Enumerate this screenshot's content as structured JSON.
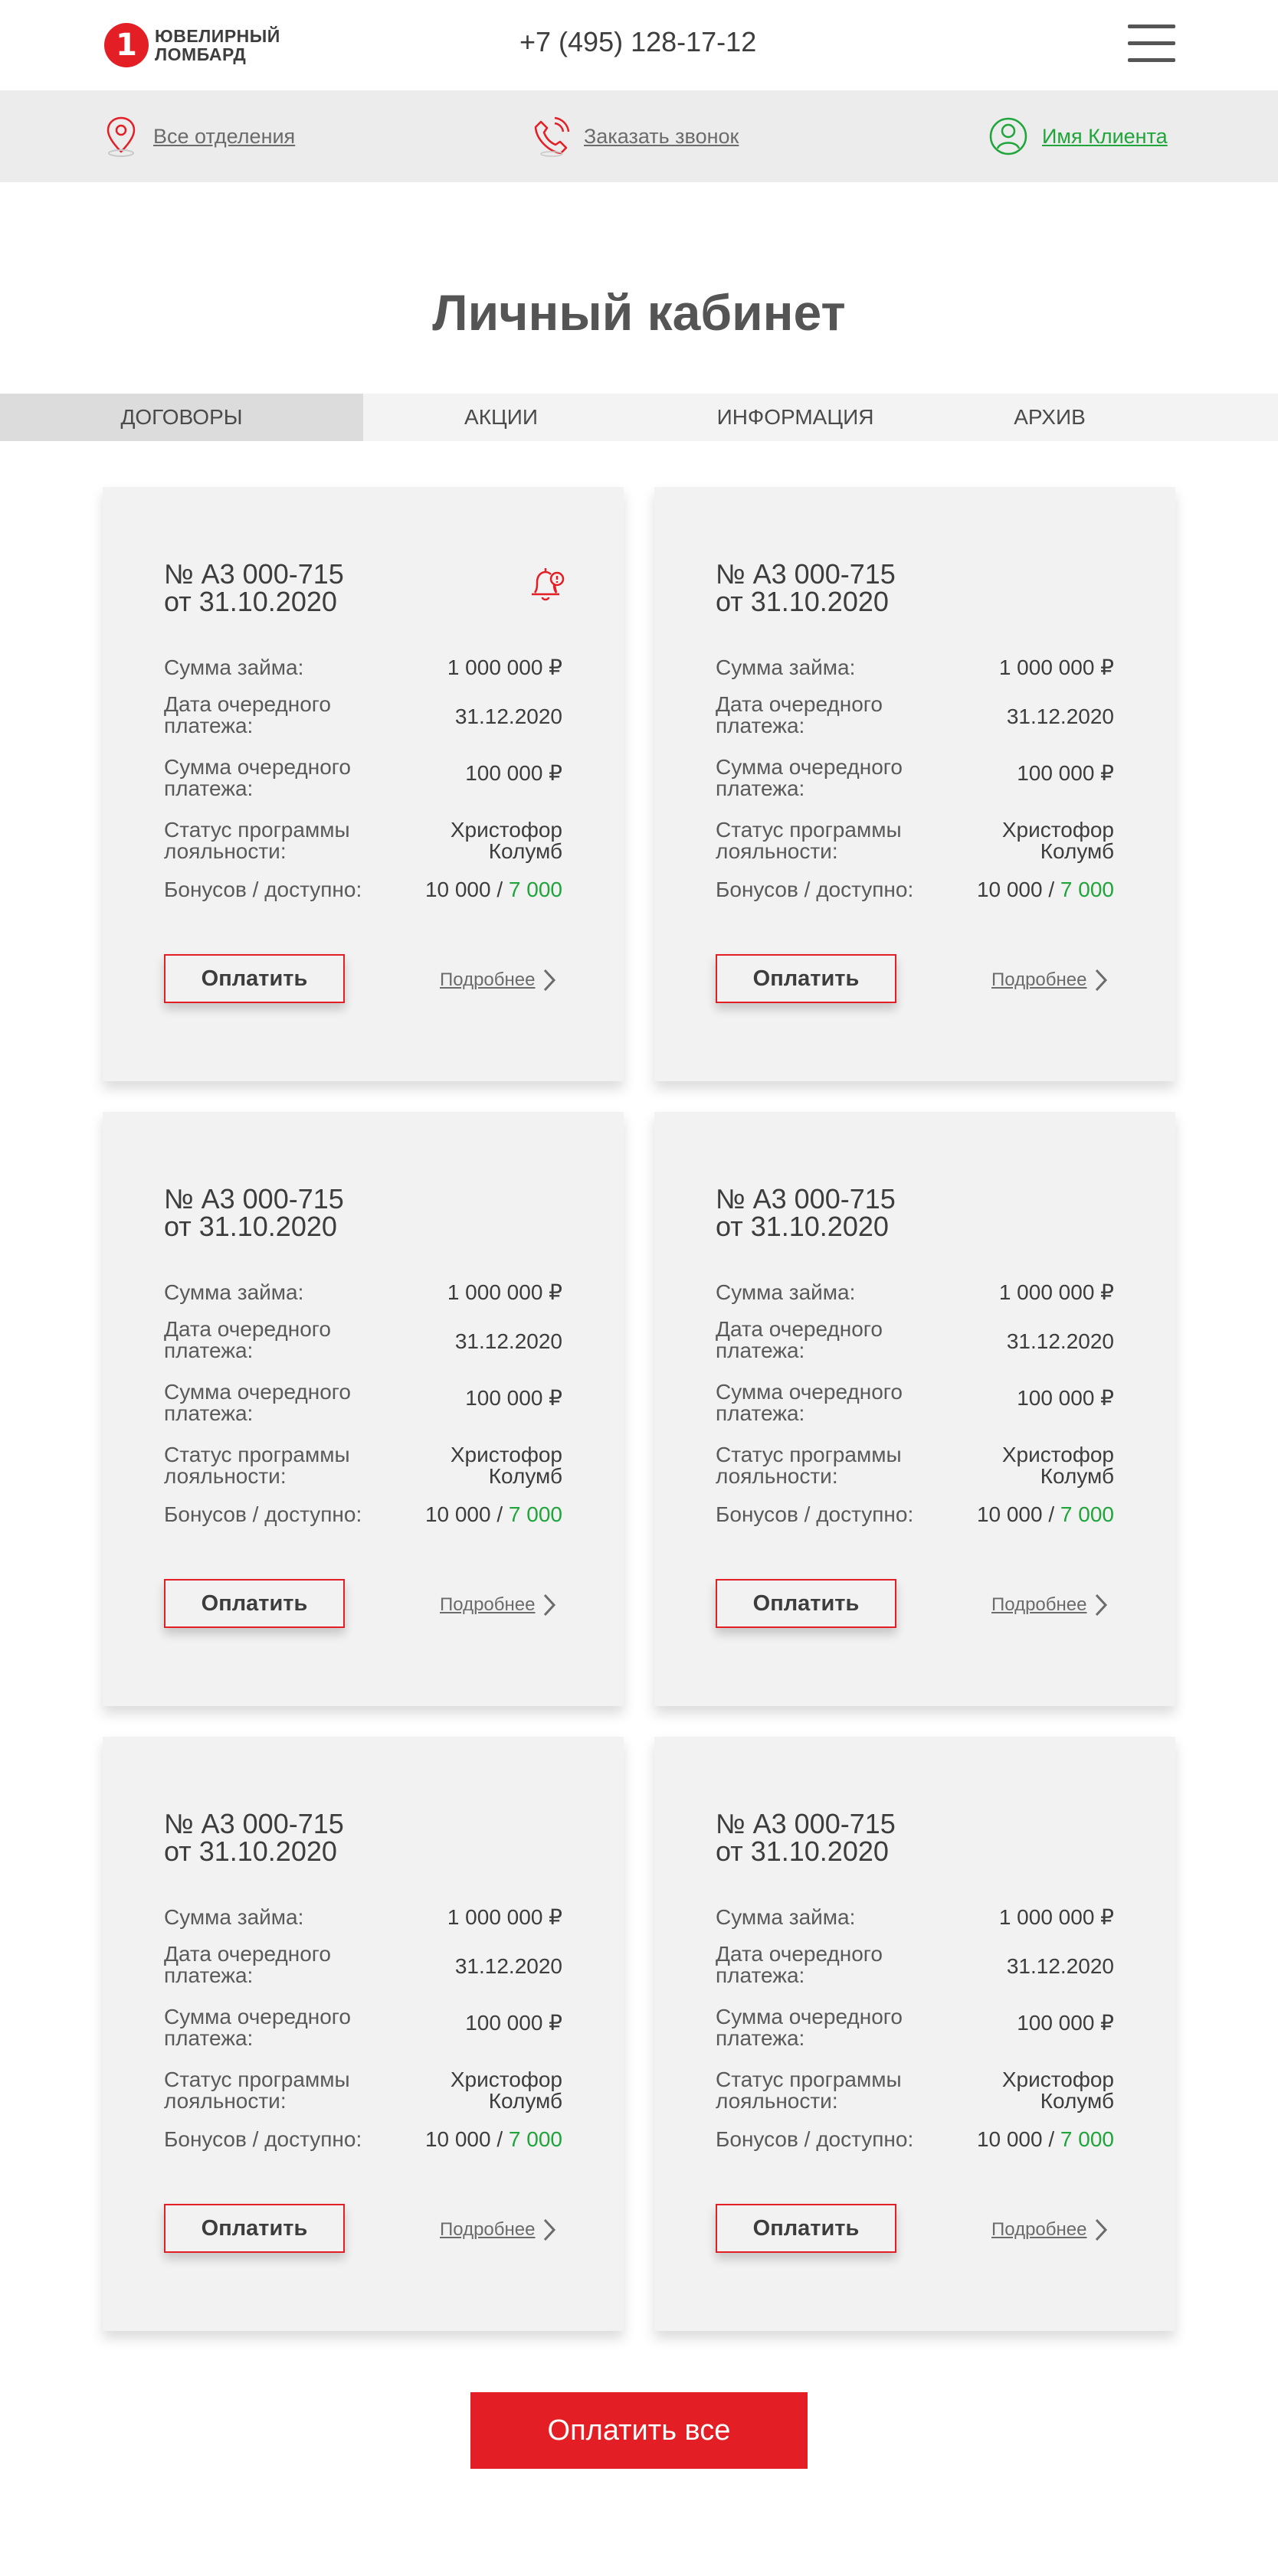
{
  "header": {
    "logo_line1": "ЮВЕЛИРНЫЙ",
    "logo_line2": "ЛОМБАРД",
    "logo_mark": "1",
    "phone": "+7 (495) 128-17-12",
    "menu_icon": "burger-menu-icon"
  },
  "subnav": {
    "branches": "Все отделения",
    "callback": "Заказать звонок",
    "client": "Имя Клиента"
  },
  "page": {
    "title": "Личный кабинет"
  },
  "tabs": [
    {
      "label": "ДОГОВОРЫ",
      "active": true
    },
    {
      "label": "АКЦИИ",
      "active": false
    },
    {
      "label": "ИНФОРМАЦИЯ",
      "active": false
    },
    {
      "label": "АРХИВ",
      "active": false
    }
  ],
  "labels": {
    "loan_sum": "Сумма займа:",
    "next_date_1": "Дата очередного",
    "next_date_2": "платежа:",
    "next_sum_1": "Сумма очередного",
    "next_sum_2": "платежа:",
    "loyalty_1": "Статус программы",
    "loyalty_2": "лояльности:",
    "bonus": "Бонусов / доступно:",
    "pay": "Оплатить",
    "more": "Подробнее"
  },
  "cards": [
    {
      "number": "№ А3 000-715",
      "date": "от 31.10.2020",
      "loan_sum": "1 000 000 ₽",
      "next_date": "31.12.2020",
      "next_sum": "100 000 ₽",
      "loyalty_1": "Христофор",
      "loyalty_2": "Колумб",
      "bonus_total": "10 000 /",
      "bonus_available": "7 000",
      "alert": true
    },
    {
      "number": "№ А3 000-715",
      "date": "от 31.10.2020",
      "loan_sum": "1 000 000 ₽",
      "next_date": "31.12.2020",
      "next_sum": "100 000 ₽",
      "loyalty_1": "Христофор",
      "loyalty_2": "Колумб",
      "bonus_total": "10 000 /",
      "bonus_available": "7 000",
      "alert": false
    },
    {
      "number": "№ А3 000-715",
      "date": "от 31.10.2020",
      "loan_sum": "1 000 000 ₽",
      "next_date": "31.12.2020",
      "next_sum": "100 000 ₽",
      "loyalty_1": "Христофор",
      "loyalty_2": "Колумб",
      "bonus_total": "10 000 /",
      "bonus_available": "7 000",
      "alert": false
    },
    {
      "number": "№ А3 000-715",
      "date": "от 31.10.2020",
      "loan_sum": "1 000 000 ₽",
      "next_date": "31.12.2020",
      "next_sum": "100 000 ₽",
      "loyalty_1": "Христофор",
      "loyalty_2": "Колумб",
      "bonus_total": "10 000 /",
      "bonus_available": "7 000",
      "alert": false
    },
    {
      "number": "№ А3 000-715",
      "date": "от 31.10.2020",
      "loan_sum": "1 000 000 ₽",
      "next_date": "31.12.2020",
      "next_sum": "100 000 ₽",
      "loyalty_1": "Христофор",
      "loyalty_2": "Колумб",
      "bonus_total": "10 000 /",
      "bonus_available": "7 000",
      "alert": false
    },
    {
      "number": "№ А3 000-715",
      "date": "от 31.10.2020",
      "loan_sum": "1 000 000 ₽",
      "next_date": "31.12.2020",
      "next_sum": "100 000 ₽",
      "loyalty_1": "Христофор",
      "loyalty_2": "Колумб",
      "bonus_total": "10 000 /",
      "bonus_available": "7 000",
      "alert": false
    }
  ],
  "pay_all": "Оплатить все",
  "colors": {
    "brand_red": "#e31e24",
    "accent_green": "#1fa53a",
    "card_bg": "#f2f2f2"
  }
}
